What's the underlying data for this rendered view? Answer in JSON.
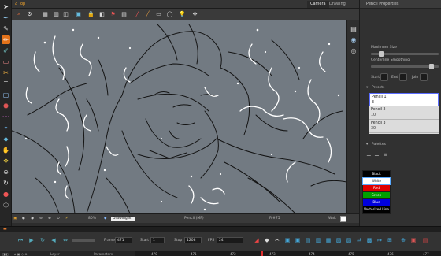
{
  "view_tabs": {
    "top_view": "Top",
    "camera": "Camera",
    "drawing": "Drawing"
  },
  "camera_status": {
    "zoom": "80%",
    "drawing_name": "Drawing 87",
    "pencil": "Pencil (MP)",
    "fps": "Fr#75",
    "color": "Wait"
  },
  "right_panel": {
    "title": "Pencil Properties",
    "maximum_size_label": "Maximum Size",
    "centerline_smoothing_label": "Centerline Smoothing",
    "tip_labels": {
      "start": "Start",
      "end": "End",
      "join": "Join"
    },
    "presets_header": "Presets",
    "presets": [
      {
        "name": "Pencil 1",
        "size": "3"
      },
      {
        "name": "Pencil 2",
        "size": "10"
      },
      {
        "name": "Pencil 3",
        "size": "30"
      }
    ],
    "palettes_header": "Palettes",
    "swatches": [
      {
        "name": "Black",
        "color": "#000000",
        "text": "#ffffff"
      },
      {
        "name": "White",
        "color": "#ffffff",
        "text": "#111111"
      },
      {
        "name": "Red",
        "color": "#e00000",
        "text": "#ffffff"
      },
      {
        "name": "Green",
        "color": "#00a000",
        "text": "#ffffff"
      },
      {
        "name": "Blue",
        "color": "#0000dd",
        "text": "#ffffff"
      },
      {
        "name": "Vectorized Line",
        "color": "#000000",
        "text": "#ffffff"
      }
    ]
  },
  "timeline": {
    "frame_label": "Frame",
    "frame_value": "471",
    "start_label": "Start",
    "start_value": "1",
    "stop_label": "Stop",
    "stop_value": "1208",
    "fps_label": "FPS",
    "fps_value": "24",
    "footer_layer": "Layer",
    "footer_params": "Parameters",
    "ruler_ticks": [
      "470",
      "471",
      "472",
      "473",
      "474",
      "475",
      "476",
      "477"
    ]
  },
  "icons": [
    "brush-icon",
    "pencil-icon",
    "eraser-icon",
    "select-icon",
    "paint-icon",
    "zoom-icon",
    "play-icon",
    "stop-icon",
    "loop-icon",
    "sound-icon"
  ]
}
